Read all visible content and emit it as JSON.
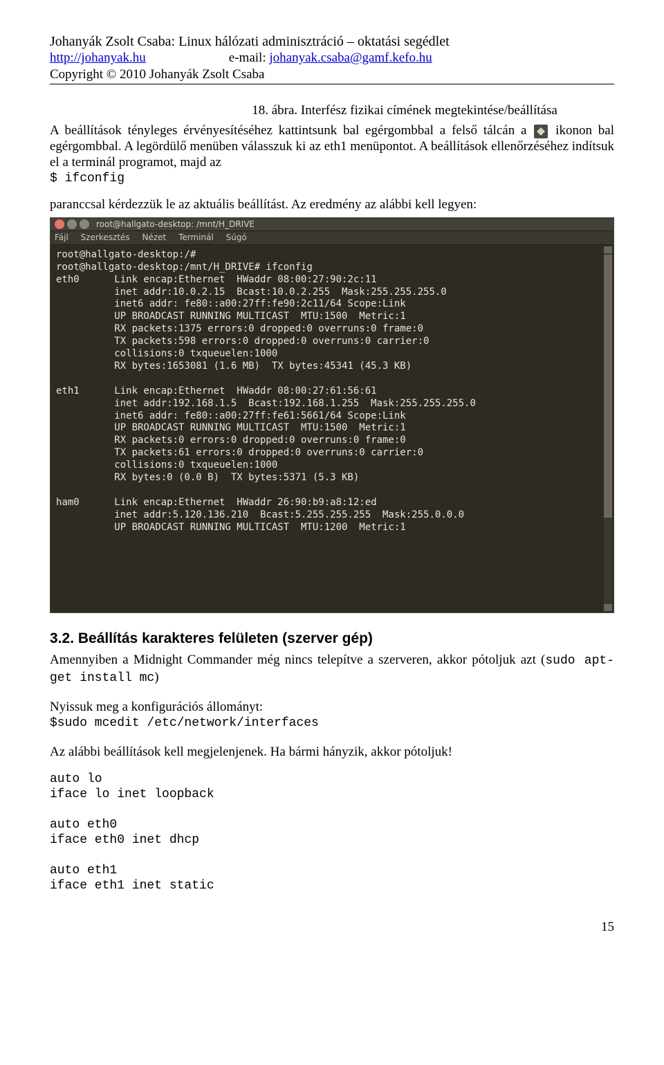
{
  "header": {
    "title": "Johanyák Zsolt Csaba: Linux hálózati adminisztráció – oktatási segédlet",
    "url": "http://johanyak.hu",
    "email_prefix": "e-mail: ",
    "email": "johanyak.csaba@gamf.kefo.hu",
    "copyright": "Copyright © 2010 Johanyák Zsolt Csaba"
  },
  "fig_caption": "18. ábra. Interfész fizikai címének megtekintése/beállítása",
  "para1_a": "A beállítások tényleges érvényesítéséhez kattintsunk bal egérgombbal a felső tálcán a ",
  "para1_b": "ikonon bal egérgombbal. A legördülő menüben válasszuk ki az eth1 menüpontot. A beállítások ellenőrzéséhez indítsuk el a terminál programot, majd az",
  "cmd1": "$ ifconfig",
  "para2_a": "paranccsal kérdezzük le az aktuális beállítást. Az eredmény az alábbi kell legyen:",
  "terminal": {
    "title": "root@hallgato-desktop: /mnt/H_DRIVE",
    "menus": [
      "Fájl",
      "Szerkesztés",
      "Nézet",
      "Terminál",
      "Súgó"
    ],
    "lines": [
      "root@hallgato-desktop:/#",
      "root@hallgato-desktop:/mnt/H_DRIVE# ifconfig",
      "eth0      Link encap:Ethernet  HWaddr 08:00:27:90:2c:11",
      "          inet addr:10.0.2.15  Bcast:10.0.2.255  Mask:255.255.255.0",
      "          inet6 addr: fe80::a00:27ff:fe90:2c11/64 Scope:Link",
      "          UP BROADCAST RUNNING MULTICAST  MTU:1500  Metric:1",
      "          RX packets:1375 errors:0 dropped:0 overruns:0 frame:0",
      "          TX packets:598 errors:0 dropped:0 overruns:0 carrier:0",
      "          collisions:0 txqueuelen:1000",
      "          RX bytes:1653081 (1.6 MB)  TX bytes:45341 (45.3 KB)",
      "",
      "eth1      Link encap:Ethernet  HWaddr 08:00:27:61:56:61",
      "          inet addr:192.168.1.5  Bcast:192.168.1.255  Mask:255.255.255.0",
      "          inet6 addr: fe80::a00:27ff:fe61:5661/64 Scope:Link",
      "          UP BROADCAST RUNNING MULTICAST  MTU:1500  Metric:1",
      "          RX packets:0 errors:0 dropped:0 overruns:0 frame:0",
      "          TX packets:61 errors:0 dropped:0 overruns:0 carrier:0",
      "          collisions:0 txqueuelen:1000",
      "          RX bytes:0 (0.0 B)  TX bytes:5371 (5.3 KB)",
      "",
      "ham0      Link encap:Ethernet  HWaddr 26:90:b9:a8:12:ed",
      "          inet addr:5.120.136.210  Bcast:5.255.255.255  Mask:255.0.0.0",
      "          UP BROADCAST RUNNING MULTICAST  MTU:1200  Metric:1"
    ]
  },
  "section_title": "3.2. Beállítás karakteres felületen (szerver gép)",
  "para3_a": "Amennyiben a Midnight Commander még nincs telepítve a szerveren, akkor pótoljuk azt (",
  "para3_cmd": "sudo apt-get install mc",
  "para3_b": ")",
  "para4": "Nyissuk meg a konfigurációs állományt:",
  "cmd2": "$sudo mcedit /etc/network/interfaces",
  "para5": "Az alábbi beállítások kell megjelenjenek. Ha bármi hányzik, akkor pótoljuk!",
  "cfg": [
    "auto lo",
    "iface lo inet loopback",
    "",
    "auto eth0",
    "iface eth0 inet dhcp",
    "",
    "auto eth1",
    "iface eth1 inet static"
  ],
  "page_number": "15"
}
